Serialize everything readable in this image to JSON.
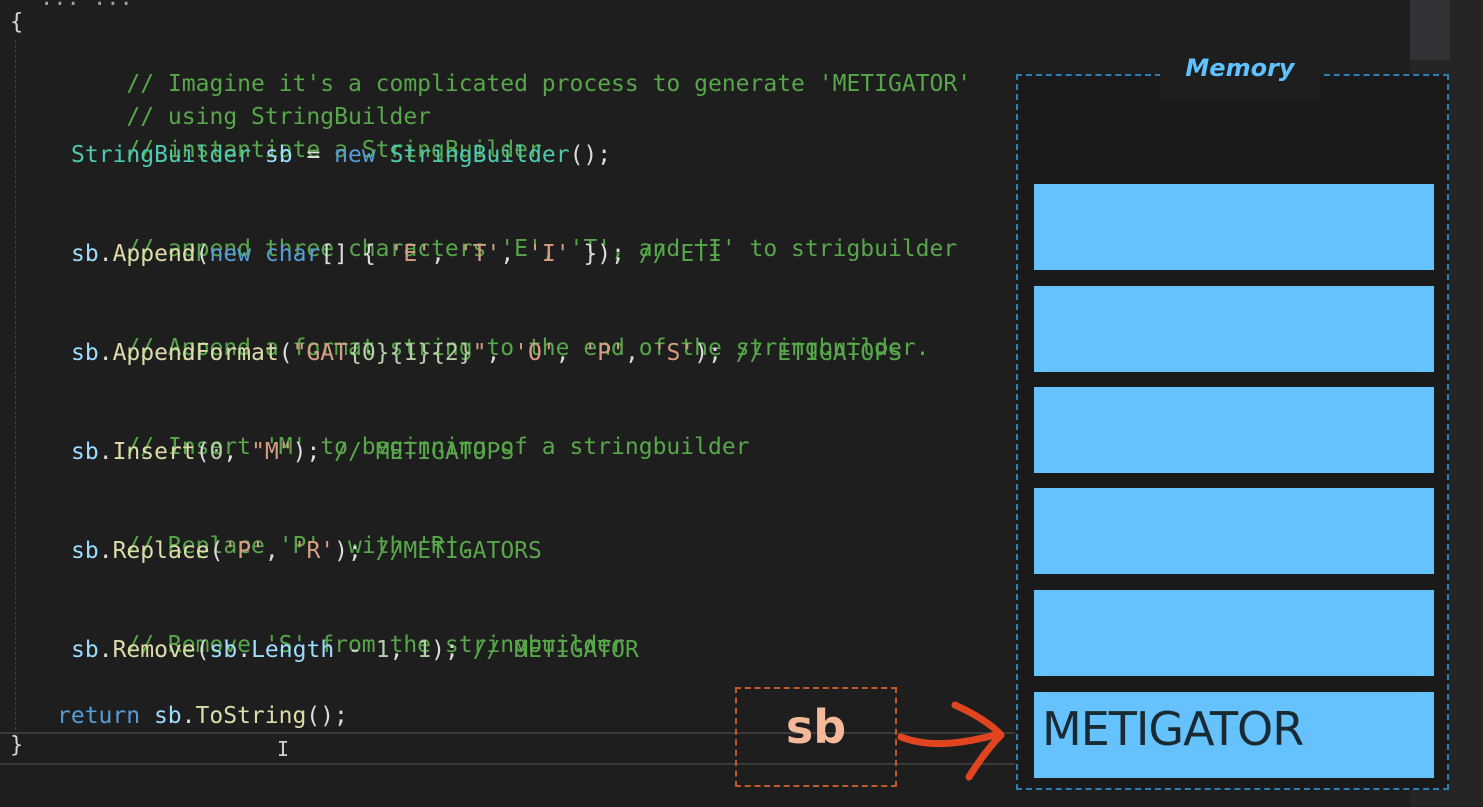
{
  "editor": {
    "top_line": "... ...",
    "open_brace": "{",
    "close_brace": "}",
    "caret": "I",
    "lines": [
      {
        "c1": "// Imagine it's a complicated process to generate 'METIGATOR'"
      },
      {
        "c1": "// using StringBuilder"
      },
      {
        "c1": "// instantiate a StringBuilder"
      },
      {
        "type": "StringBuilder",
        "var": "sb",
        "eq": "=",
        "kw": "new",
        "ctor": "StringBuilder",
        "tail": "();"
      },
      {
        "c1": "// append three characters 'E', 'T', and 'I' to strigbuilder"
      },
      {
        "obj": "sb",
        "dot": ".",
        "method": "Append",
        "open": "(",
        "kw1": "new",
        "kw2": "char",
        "mid": "[] { ",
        "s1": "'E'",
        "sep1": ", ",
        "s2": "'T'",
        "sep2": ", ",
        "s3": "'I'",
        "tail": " });",
        "comment": " // ETI"
      },
      {
        "c1": "// Append a format string to the end of the stringbuilder."
      },
      {
        "obj": "sb",
        "dot": ".",
        "method": "AppendFormat",
        "open": "(",
        "fmt_a": "\"GAT",
        "fmt_b": "{0}{1}{2}",
        "fmt_c": "\"",
        "sep0": ", ",
        "s1": "'O'",
        "sep1": ", ",
        "s2": "'P'",
        "sep2": ", ",
        "s3": "'S'",
        "tail": ");",
        "comment": " // ETIGATOPS"
      },
      {
        "c1": "// Insert 'M' to beginning of a stringbuilder"
      },
      {
        "obj": "sb",
        "dot": ".",
        "method": "Insert",
        "open": "(",
        "num": "0",
        "sep": ", ",
        "s1": "\"M\"",
        "tail": ");",
        "comment": " // METIGATOPS"
      },
      {
        "c1": "// Replace 'P'  with 'R'."
      },
      {
        "obj": "sb",
        "dot": ".",
        "method": "Replace",
        "open": "(",
        "s1": "'P'",
        "sep": ", ",
        "s2": "'R'",
        "tail": ");",
        "comment": " //METIGATORS"
      },
      {
        "c1": "// Remove 'S' from the stringbuilder"
      },
      {
        "obj": "sb",
        "dot": ".",
        "method": "Remove",
        "open": "(",
        "obj2": "sb",
        "dot2": ".",
        "prop": "Length",
        "mid": " - ",
        "n1": "1",
        "sep": ", ",
        "n2": "1",
        "tail": ");",
        "comment": " // METIGATOR"
      },
      {
        "kw": "return",
        "sp": " ",
        "obj": "sb",
        "dot": ".",
        "method": "ToString",
        "tail": "();"
      }
    ]
  },
  "memory": {
    "title": "Memory",
    "cells": [
      "",
      "",
      "",
      "",
      "",
      "METIGATOR"
    ]
  },
  "pointer": {
    "label": "sb",
    "arrow_color": "#e0451f",
    "cell_color": "#66c2fc"
  }
}
